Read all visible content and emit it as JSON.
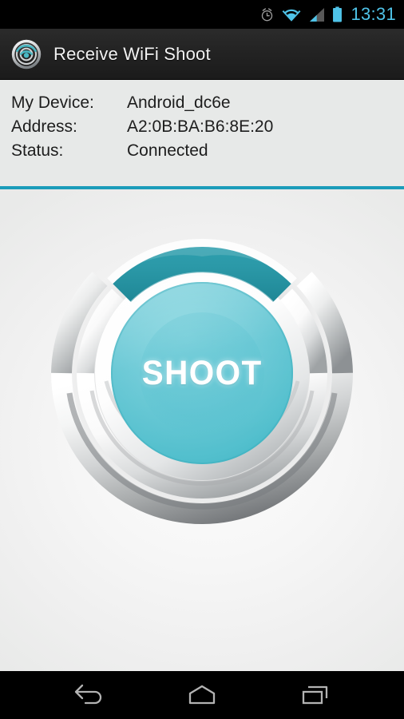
{
  "status_bar": {
    "time": "13:31",
    "icons": [
      {
        "name": "alarm-clock-icon",
        "label": "alarm"
      },
      {
        "name": "wifi-icon",
        "label": "wifi"
      },
      {
        "name": "cellular-signal-icon",
        "label": "signal"
      },
      {
        "name": "battery-icon",
        "label": "battery"
      }
    ],
    "accent_color": "#4fc3e8"
  },
  "action_bar": {
    "title": "Receive WiFi Shoot",
    "icon": "wifi-radar-app-icon",
    "background_color": "#232323",
    "title_color": "#f2f2f2"
  },
  "info_panel": {
    "background_color": "#e7e9e8",
    "rows": [
      {
        "label": "My Device:",
        "value": "Android_dc6e"
      },
      {
        "label": "Address:",
        "value": "A2:0B:BA:B6:8E:20"
      },
      {
        "label": "Status:",
        "value": "Connected"
      }
    ],
    "divider_color": "#1b9cba"
  },
  "main": {
    "shoot_button": {
      "label": "SHOOT",
      "inner_color": "#64c8d6",
      "arc_color": "#2a9aaa",
      "ring_color": "#c9cbcb",
      "label_color": "#ffffff"
    },
    "background_color": "#f5f5f5"
  },
  "nav_bar": {
    "background_color": "#000000",
    "buttons": [
      {
        "name": "back-button",
        "icon": "back-arrow-icon"
      },
      {
        "name": "home-button",
        "icon": "home-icon"
      },
      {
        "name": "recent-apps-button",
        "icon": "recent-apps-icon"
      }
    ]
  }
}
